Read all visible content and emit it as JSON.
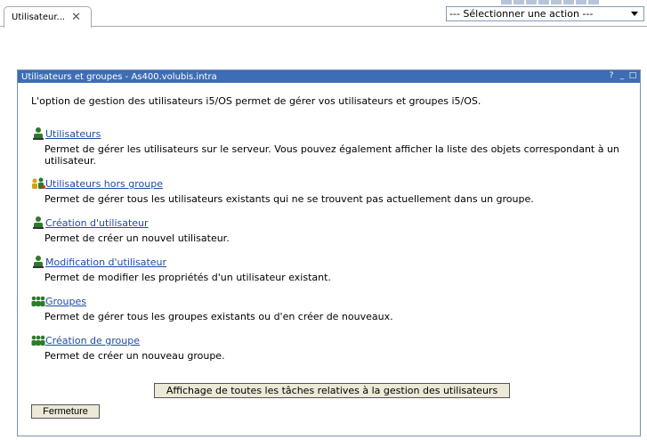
{
  "tab": {
    "label": "Utilisateur...",
    "close": "✕"
  },
  "action_select": {
    "value": "--- Sélectionner une action ---"
  },
  "portlet": {
    "title": "Utilisateurs et groupes - As400.volubis.intra",
    "controls": [
      "?",
      "_",
      "□"
    ],
    "intro": "L'option de gestion des utilisateurs i5/OS permet de gérer vos utilisateurs et groupes i5/OS.",
    "items": [
      {
        "label": "Utilisateurs",
        "desc": "Permet de gérer les utilisateurs sur le serveur. Vous pouvez également afficher la liste des objets correspondant à un utilisateur.",
        "icon": "user-icon"
      },
      {
        "label": "Utilisateurs hors groupe",
        "desc": "Permet de gérer tous les utilisateurs existants qui ne se trouvent pas actuellement dans un groupe.",
        "icon": "users-no-group-icon"
      },
      {
        "label": "Création d'utilisateur",
        "desc": "Permet de créer un nouvel utilisateur.",
        "icon": "create-user-icon"
      },
      {
        "label": "Modification d'utilisateur",
        "desc": "Permet de modifier les propriétés d'un utilisateur existant.",
        "icon": "edit-user-icon"
      },
      {
        "label": "Groupes",
        "desc": "Permet de gérer tous les groupes existants ou d'en créer de nouveaux.",
        "icon": "group-icon"
      },
      {
        "label": "Création de groupe",
        "desc": "Permet de créer un nouveau groupe.",
        "icon": "create-group-icon"
      }
    ],
    "all_tasks_button": "Affichage de toutes les tâches relatives à la gestion des utilisateurs",
    "close_button": "Fermeture"
  }
}
